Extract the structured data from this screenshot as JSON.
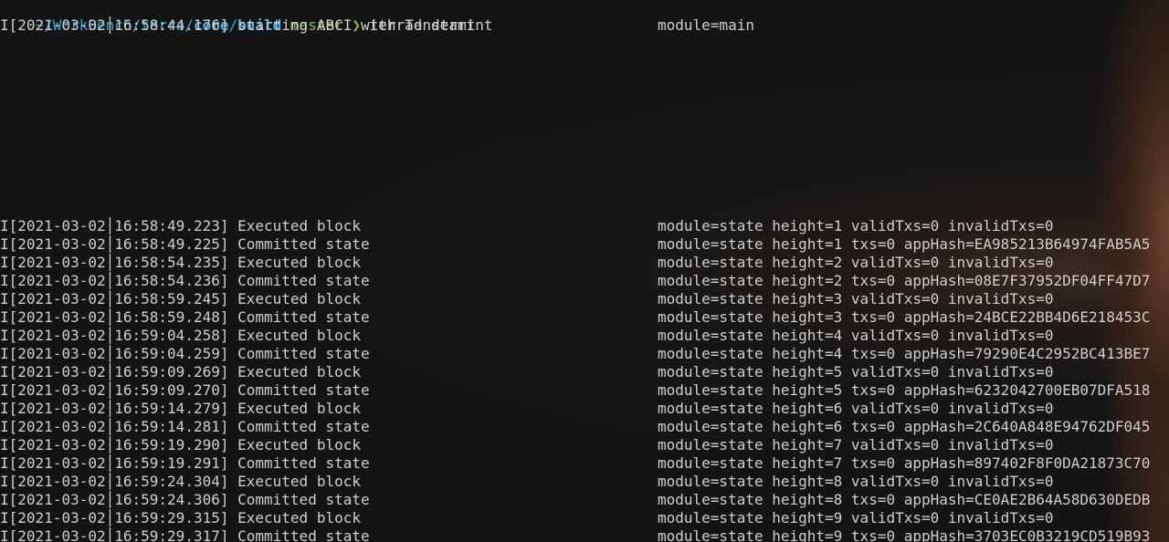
{
  "prompt": {
    "tilde": "~",
    "path_prefix": "/WorkBench/terra/",
    "path_core": "core",
    "path_slash": "/",
    "path_build": "build",
    "branch": "master",
    "arrow": "❯",
    "command": "terrad start"
  },
  "logs": [
    {
      "level": "I",
      "date": "[2021-03-02",
      "time": "16:58:44.176]",
      "message": "starting ABCI with Tendermint",
      "detail": "module=main"
    },
    {
      "level": "I",
      "date": "[2021-03-02",
      "time": "16:58:49.223]",
      "message": "Executed block",
      "detail": "module=state height=1 validTxs=0 invalidTxs=0"
    },
    {
      "level": "I",
      "date": "[2021-03-02",
      "time": "16:58:49.225]",
      "message": "Committed state",
      "detail": "module=state height=1 txs=0 appHash=EA985213B64974FAB5A5"
    },
    {
      "level": "I",
      "date": "[2021-03-02",
      "time": "16:58:54.235]",
      "message": "Executed block",
      "detail": "module=state height=2 validTxs=0 invalidTxs=0"
    },
    {
      "level": "I",
      "date": "[2021-03-02",
      "time": "16:58:54.236]",
      "message": "Committed state",
      "detail": "module=state height=2 txs=0 appHash=08E7F37952DF04FF47D7"
    },
    {
      "level": "I",
      "date": "[2021-03-02",
      "time": "16:58:59.245]",
      "message": "Executed block",
      "detail": "module=state height=3 validTxs=0 invalidTxs=0"
    },
    {
      "level": "I",
      "date": "[2021-03-02",
      "time": "16:58:59.248]",
      "message": "Committed state",
      "detail": "module=state height=3 txs=0 appHash=24BCE22BB4D6E218453C"
    },
    {
      "level": "I",
      "date": "[2021-03-02",
      "time": "16:59:04.258]",
      "message": "Executed block",
      "detail": "module=state height=4 validTxs=0 invalidTxs=0"
    },
    {
      "level": "I",
      "date": "[2021-03-02",
      "time": "16:59:04.259]",
      "message": "Committed state",
      "detail": "module=state height=4 txs=0 appHash=79290E4C2952BC413BE7"
    },
    {
      "level": "I",
      "date": "[2021-03-02",
      "time": "16:59:09.269]",
      "message": "Executed block",
      "detail": "module=state height=5 validTxs=0 invalidTxs=0"
    },
    {
      "level": "I",
      "date": "[2021-03-02",
      "time": "16:59:09.270]",
      "message": "Committed state",
      "detail": "module=state height=5 txs=0 appHash=6232042700EB07DFA518"
    },
    {
      "level": "I",
      "date": "[2021-03-02",
      "time": "16:59:14.279]",
      "message": "Executed block",
      "detail": "module=state height=6 validTxs=0 invalidTxs=0"
    },
    {
      "level": "I",
      "date": "[2021-03-02",
      "time": "16:59:14.281]",
      "message": "Committed state",
      "detail": "module=state height=6 txs=0 appHash=2C640A848E94762DF045"
    },
    {
      "level": "I",
      "date": "[2021-03-02",
      "time": "16:59:19.290]",
      "message": "Executed block",
      "detail": "module=state height=7 validTxs=0 invalidTxs=0"
    },
    {
      "level": "I",
      "date": "[2021-03-02",
      "time": "16:59:19.291]",
      "message": "Committed state",
      "detail": "module=state height=7 txs=0 appHash=897402F8F0DA21873C70"
    },
    {
      "level": "I",
      "date": "[2021-03-02",
      "time": "16:59:24.304]",
      "message": "Executed block",
      "detail": "module=state height=8 validTxs=0 invalidTxs=0"
    },
    {
      "level": "I",
      "date": "[2021-03-02",
      "time": "16:59:24.306]",
      "message": "Committed state",
      "detail": "module=state height=8 txs=0 appHash=CE0AE2B64A58D630DEDB"
    },
    {
      "level": "I",
      "date": "[2021-03-02",
      "time": "16:59:29.315]",
      "message": "Executed block",
      "detail": "module=state height=9 validTxs=0 invalidTxs=0"
    },
    {
      "level": "I",
      "date": "[2021-03-02",
      "time": "16:59:29.317]",
      "message": "Committed state",
      "detail": "module=state height=9 txs=0 appHash=3703EC0B3219CD519B93"
    }
  ],
  "colors": {
    "background": "#141414",
    "text": "#cfcfcf",
    "path": "#2fa8d8",
    "branch": "#7fc242"
  }
}
